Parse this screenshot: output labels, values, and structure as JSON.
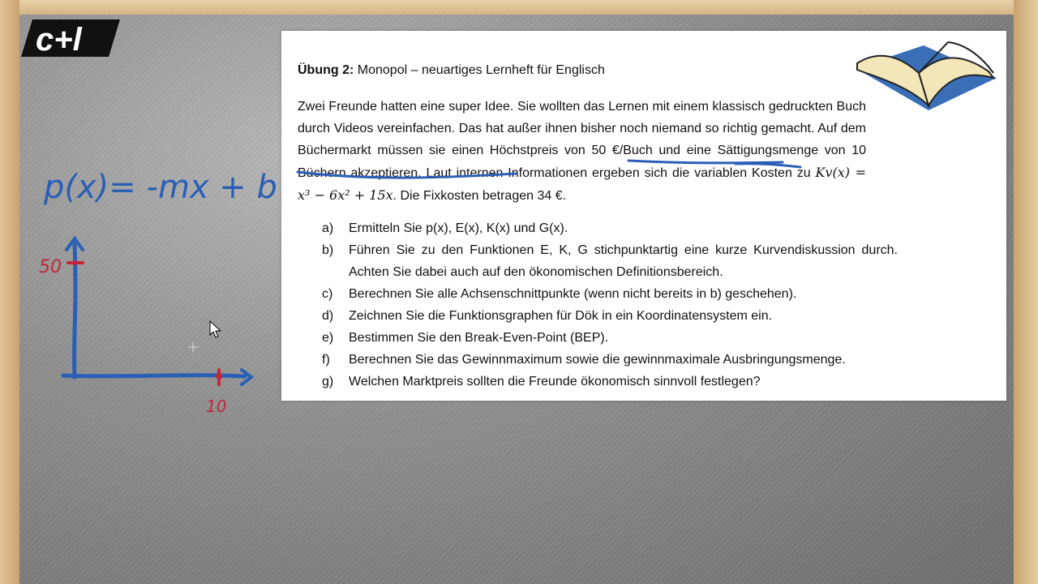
{
  "branding": {
    "logo_text": "c+l"
  },
  "sketch": {
    "formula": "p(x)= -mx + b",
    "y_mark": "50",
    "x_mark": "10",
    "colors": {
      "blue": "#2a5fb5",
      "red": "#c2273c"
    }
  },
  "exercise": {
    "title_bold": "Übung 2:",
    "title_rest": "Monopol – neuartiges Lernheft für Englisch",
    "para_1": "Zwei Freunde hatten eine super Idee. Sie wollten das Lernen mit einem klassisch gedruckten Buch durch Videos vereinfachen. Das hat außer ihnen bisher noch niemand so richtig gemacht. Auf dem Büchermarkt müssen sie einen ",
    "highlight_1": "Höchstpreis von 50 €/Buch",
    "para_2": " und eine ",
    "highlight_2": "Sättigungsmenge von 10 Büchern",
    "para_3": " akzeptieren. Laut internen Informationen ergeben sich die variablen Kosten zu ",
    "cost_function": "Kv(x) = x³ − 6x² + 15x",
    "para_4": ". Die Fixkosten betragen 34 €.",
    "tasks": [
      {
        "label": "a)",
        "text": "Ermitteln Sie p(x), E(x), K(x) und G(x)."
      },
      {
        "label": "b)",
        "text": "Führen Sie zu den Funktionen E, K, G stichpunktartig eine kurze Kurvendiskussion durch. Achten Sie dabei auch auf den ökonomischen Definitionsbereich."
      },
      {
        "label": "c)",
        "text": "Berechnen Sie alle Achsenschnittpunkte (wenn nicht bereits in b) geschehen)."
      },
      {
        "label": "d)",
        "text": "Zeichnen Sie die Funktionsgraphen für Dök in ein Koordinatensystem ein."
      },
      {
        "label": "e)",
        "text": "Bestimmen Sie den Break-Even-Point (BEP)."
      },
      {
        "label": "f)",
        "text": "Berechnen Sie das Gewinnmaximum sowie die gewinnmaximale Ausbringungsmenge."
      },
      {
        "label": "g)",
        "text": "Welchen Marktpreis sollten die Freunde ökonomisch sinnvoll festlegen?"
      }
    ]
  }
}
